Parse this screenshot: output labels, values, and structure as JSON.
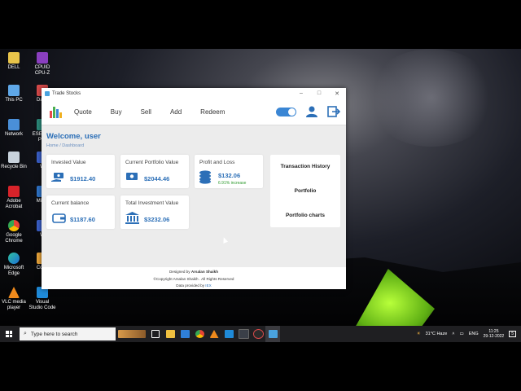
{
  "window": {
    "title": "Trade Stocks",
    "controls": {
      "minimize": "–",
      "maximize": "□",
      "close": "✕"
    }
  },
  "nav": {
    "items": [
      "Quote",
      "Buy",
      "Sell",
      "Add",
      "Redeem"
    ],
    "theme_toggle_on": true
  },
  "welcome": "Welcome, user",
  "breadcrumb": "Home / Dashboard",
  "cards": {
    "invested": {
      "label": "Invested Value",
      "value": "$1912.40"
    },
    "portfolio_value": {
      "label": "Current Portfolio Value",
      "value": "$2044.46"
    },
    "profit": {
      "label": "Profit and Loss",
      "value": "$132.06",
      "increase": "6.91% increase"
    },
    "balance": {
      "label": "Current balance",
      "value": "$1187.60"
    },
    "total_investment": {
      "label": "Total Investment Value",
      "value": "$3232.06"
    }
  },
  "side_panel": [
    "Transaction History",
    "Portfolio",
    "Portfolio charts"
  ],
  "footer": {
    "designed_prefix": "Designed by",
    "designer": "Arsalan Shaikh",
    "copyright": "©Copyright Arsalan Shaikh . All Rights Reserved",
    "data_prefix": "Data provided by",
    "data_provider": "IEX"
  },
  "desktop_icons": [
    {
      "label": "DELL"
    },
    {
      "label": "CPUID CPU-Z"
    },
    {
      "label": "This PC"
    },
    {
      "label": "Dash"
    },
    {
      "label": "Network"
    },
    {
      "label": "ESET I & Pay"
    },
    {
      "label": "Recycle Bin"
    },
    {
      "label": "W"
    },
    {
      "label": "Adobe Acrobat"
    },
    {
      "label": "Mic T"
    },
    {
      "label": "Google Chrome"
    },
    {
      "label": "W"
    },
    {
      "label": "Microsoft Edge"
    },
    {
      "label": "Code"
    },
    {
      "label": "VLC media player"
    },
    {
      "label": "Visual Studio Code"
    }
  ],
  "taskbar": {
    "search_placeholder": "Type here to search",
    "weather": "31°C  Haze",
    "language": "ENG",
    "time": "11:25",
    "date": "29-12-2022",
    "notification_count": "5"
  },
  "colors": {
    "accent": "#2c6fb7",
    "increase": "#2e9a2e",
    "taskbar": "#1f1f22"
  }
}
